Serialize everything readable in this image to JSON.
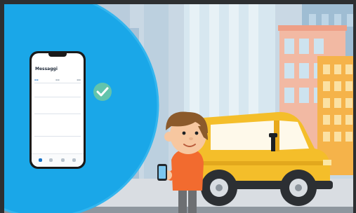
{
  "scene": {
    "description_icons": [
      "checkmark-icon",
      "smartphone",
      "yellow-car",
      "cartoon-person"
    ],
    "colors": {
      "circle": "#1aa7e8",
      "sky": "#c9d8e4",
      "car": "#f4be2a",
      "shirt": "#f26b2f",
      "pants": "#6d6f72",
      "hair": "#8b5a2b"
    }
  },
  "phone": {
    "title": "Messaggi"
  }
}
